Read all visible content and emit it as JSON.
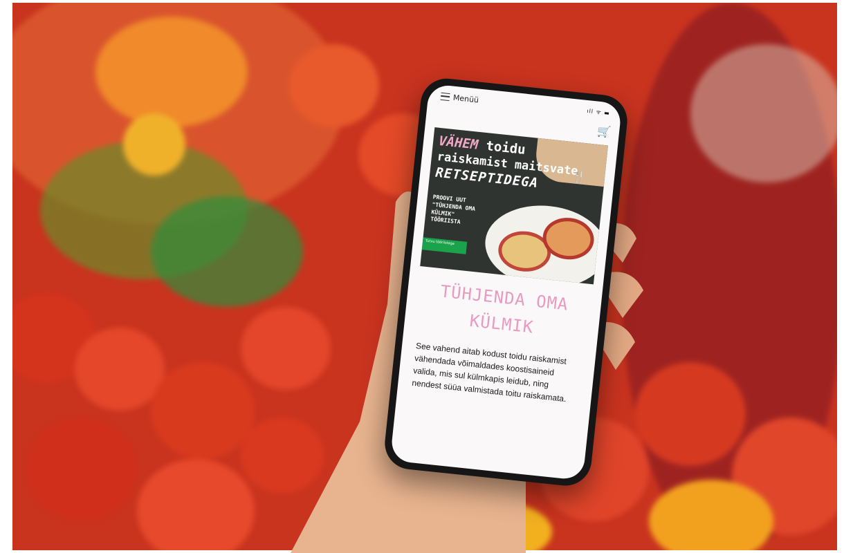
{
  "app": {
    "menu_label": "Menüü",
    "signals": "ıll ᯤ ▬",
    "cart_icon": "🛒"
  },
  "banner": {
    "line1_emphasis": "VÄHEM",
    "line1_rest": " toidu",
    "line2": "raiskamist maitsvate",
    "line3": "RETSEPTIDEGA",
    "subtext": "PROOVI UUT \"TÜHJENDA OMA KÜLMIK\" TÖÖRIISTA",
    "button_label": "Tutvu tööriistaga"
  },
  "content": {
    "headline_line1": "TÜHJENDA OMA",
    "headline_line2": "KÜLMIK",
    "description": "See vahend aitab kodust toidu raiskamist vähendada võimaldades koostisaineid valida, mis sul külmkapis leidub, ning nendest süüa valmistada toitu raiskamata."
  },
  "colors": {
    "accent_pink": "#e79bc1",
    "cart_magenta": "#c2188b",
    "button_green": "#1aa34a",
    "banner_dark": "#2f3430"
  }
}
